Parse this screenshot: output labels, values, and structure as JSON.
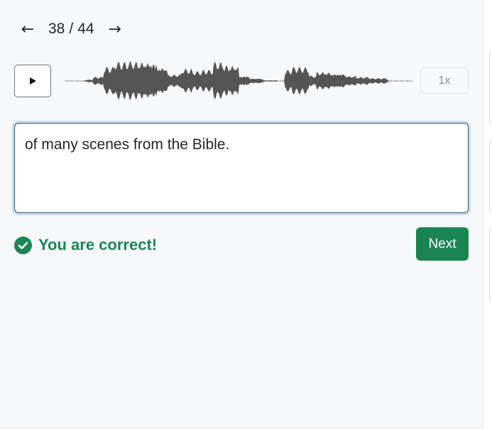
{
  "navigation": {
    "prev_icon": "arrow-left-icon",
    "next_icon": "arrow-right-icon",
    "current": "38",
    "separator": "/",
    "total": "44"
  },
  "player": {
    "play_icon": "play-icon",
    "speed_label": "1x",
    "waveform_color": "#555555"
  },
  "answer": {
    "value": "of many scenes from the Bible."
  },
  "feedback": {
    "icon": "check-circle-icon",
    "text": "You are correct!",
    "color": "#1d8654"
  },
  "actions": {
    "next_label": "Next",
    "next_color": "#1a8553"
  }
}
